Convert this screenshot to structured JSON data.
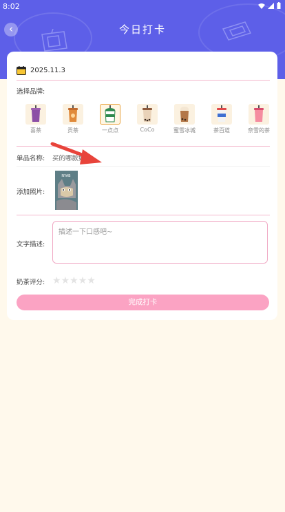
{
  "status_bar": {
    "time": "8:02"
  },
  "header": {
    "title": "今日打卡",
    "back_icon": "‹"
  },
  "form": {
    "date": "2025.11.3",
    "brand_label": "选择品牌:",
    "brands": [
      {
        "name": "喜茶",
        "selected": false
      },
      {
        "name": "贡茶",
        "selected": false
      },
      {
        "name": "一点点",
        "selected": true
      },
      {
        "name": "CoCo",
        "selected": false
      },
      {
        "name": "蜜雪冰城",
        "selected": false
      },
      {
        "name": "茶百道",
        "selected": false
      },
      {
        "name": "奈雪的茶",
        "selected": false
      }
    ],
    "product_label": "单品名称:",
    "product_value": "买的哪款奶茶",
    "photo_label": "添加照片:",
    "photo_caption": "NYAB",
    "desc_label": "文字描述:",
    "desc_placeholder": "描述一下口感吧~",
    "rating_label": "奶茶评分:",
    "rating_value": 0,
    "rating_max": 5,
    "submit_label": "完成打卡"
  },
  "colors": {
    "header": "#5D5FE8",
    "page_bg": "#FFF9EC",
    "pink_accent": "#FBA3C3",
    "divider_pink": "#F3B6CB",
    "arrow": "#E8433A"
  }
}
